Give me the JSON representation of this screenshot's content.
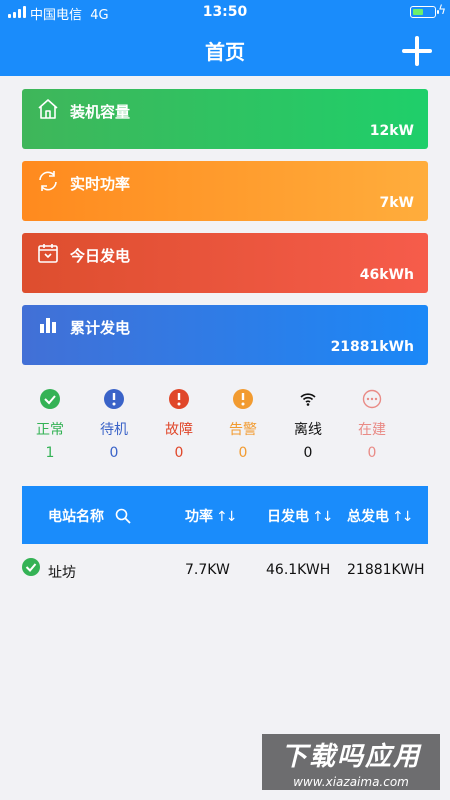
{
  "status_bar": {
    "carrier": "中国电信",
    "network": "4G",
    "time": "13:50"
  },
  "header": {
    "title": "首页"
  },
  "cards": [
    {
      "label": "装机容量",
      "value": "12kW",
      "icon": "home-icon"
    },
    {
      "label": "实时功率",
      "value": "7kW",
      "icon": "refresh-icon"
    },
    {
      "label": "今日发电",
      "value": "46kWh",
      "icon": "calendar-icon"
    },
    {
      "label": "累计发电",
      "value": "21881kWh",
      "icon": "bar-chart-icon"
    }
  ],
  "stats": [
    {
      "label": "正常",
      "count": "1",
      "color": "#34b255",
      "icon": "check-circle-icon"
    },
    {
      "label": "待机",
      "count": "0",
      "color": "#3a63c8",
      "icon": "exclamation-circle-icon"
    },
    {
      "label": "故障",
      "count": "0",
      "color": "#e0472a",
      "icon": "exclamation-circle-icon"
    },
    {
      "label": "告警",
      "count": "0",
      "color": "#f29b30",
      "icon": "exclamation-circle-icon"
    },
    {
      "label": "离线",
      "count": "0",
      "color": "#111111",
      "icon": "wifi-icon"
    },
    {
      "label": "在建",
      "count": "0",
      "color": "#e98b86",
      "icon": "ellipsis-circle-icon"
    }
  ],
  "table": {
    "headers": {
      "name": "电站名称",
      "power": "功率",
      "daily": "日发电",
      "total": "总发电"
    },
    "rows": [
      {
        "name": "址坊",
        "power": "7.7KW",
        "daily": "46.1KWH",
        "total": "21881KWH",
        "status_icon": "check-circle-icon"
      }
    ]
  },
  "watermark": {
    "title": "下载吗应用",
    "url": "www.xiazaima.com"
  }
}
